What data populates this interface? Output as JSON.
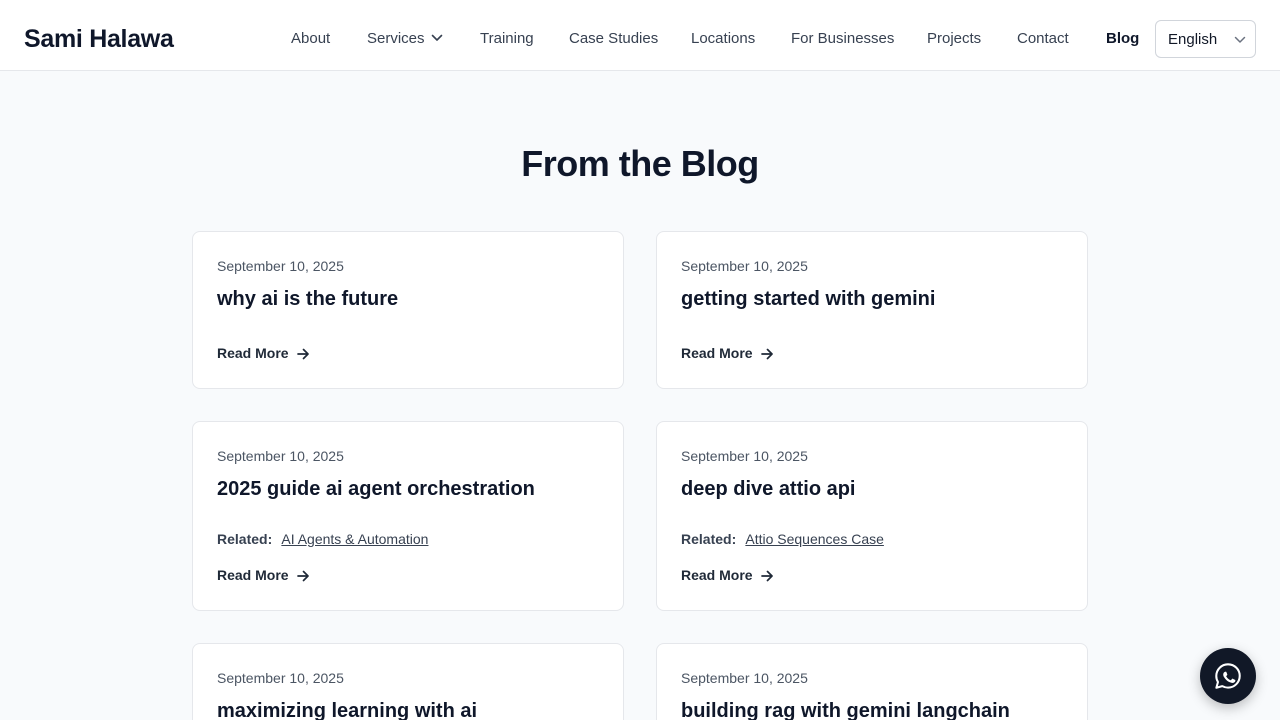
{
  "header": {
    "brand": "Sami Halawa",
    "nav": {
      "about": "About",
      "services": "Services",
      "training": "Training",
      "case_studies": "Case Studies",
      "locations": "Locations",
      "for_businesses": "For Businesses",
      "projects": "Projects",
      "contact": "Contact",
      "blog": "Blog"
    },
    "language": "English"
  },
  "section": {
    "title": "From the Blog"
  },
  "posts": [
    {
      "date": "September 10, 2025",
      "title": "why ai is the future",
      "read_more": "Read More"
    },
    {
      "date": "September 10, 2025",
      "title": "getting started with gemini",
      "read_more": "Read More"
    },
    {
      "date": "September 10, 2025",
      "title": "2025 guide ai agent orchestration",
      "related_label": "Related:",
      "related_link": "AI Agents & Automation",
      "read_more": "Read More"
    },
    {
      "date": "September 10, 2025",
      "title": "deep dive attio api",
      "related_label": "Related:",
      "related_link": "Attio Sequences Case",
      "read_more": "Read More"
    },
    {
      "date": "September 10, 2025",
      "title": "maximizing learning with ai"
    },
    {
      "date": "September 10, 2025",
      "title": "building rag with gemini langchain"
    }
  ],
  "icons": {
    "services_chevron": "chevron-down-icon",
    "language_chevron": "chevron-down-icon",
    "read_more_arrow": "arrow-right-icon",
    "whatsapp": "whatsapp-icon"
  },
  "colors": {
    "background": "#f8fafc",
    "text_primary": "#0f172a",
    "whatsapp_button": "#111827"
  }
}
